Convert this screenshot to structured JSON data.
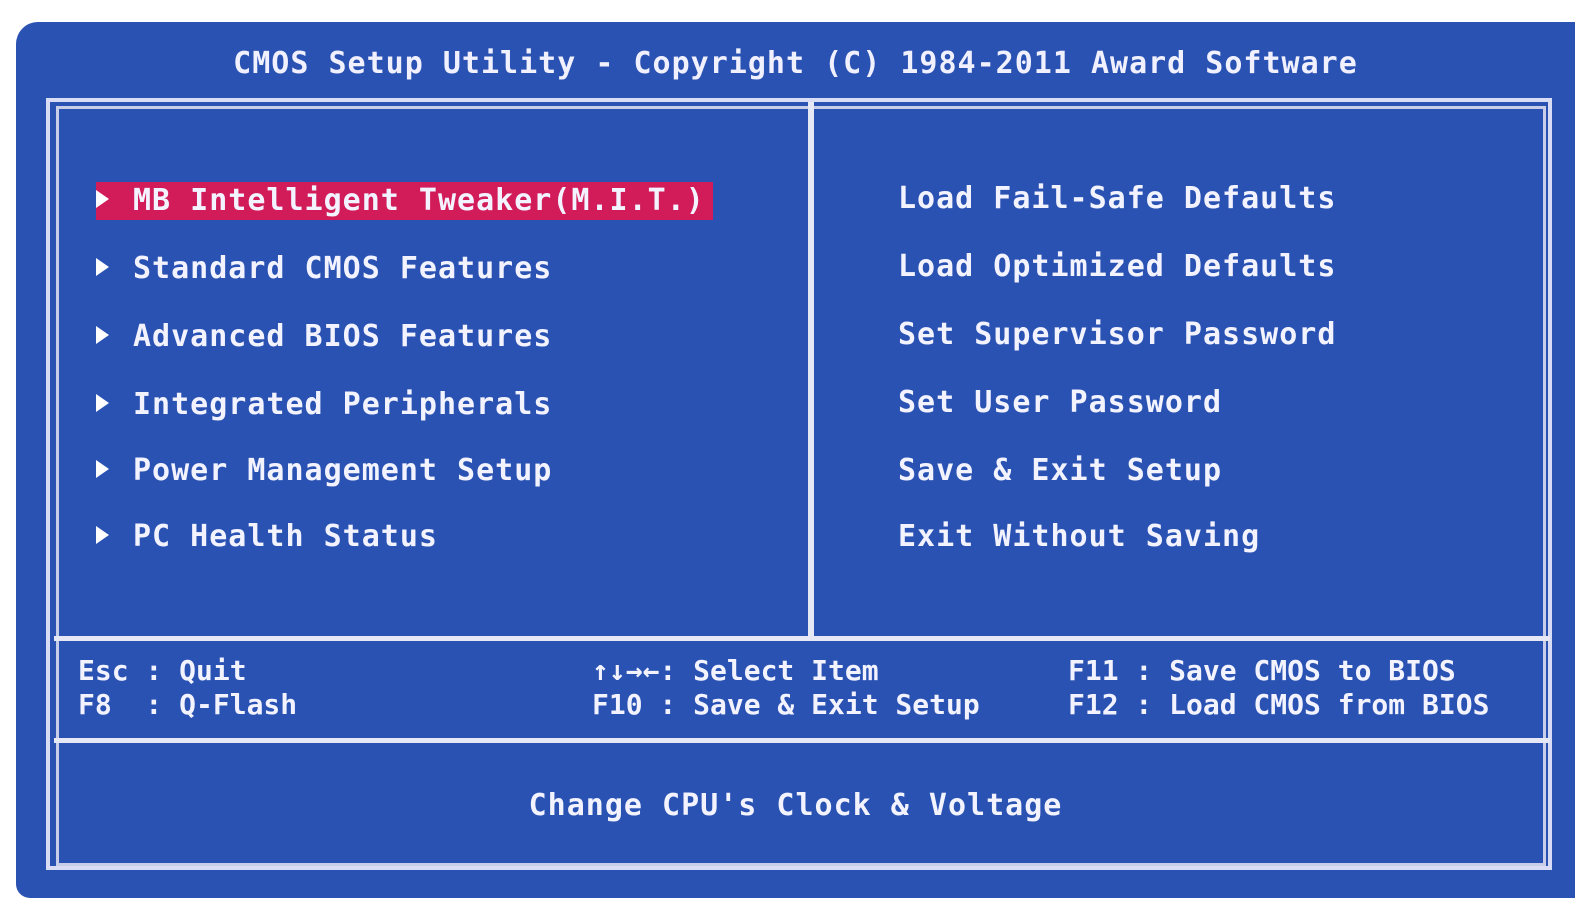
{
  "title": "CMOS Setup Utility - Copyright (C) 1984-2011 Award Software",
  "left_menu": [
    {
      "label": "MB Intelligent Tweaker(M.I.T.)",
      "selected": true
    },
    {
      "label": "Standard CMOS Features",
      "selected": false
    },
    {
      "label": "Advanced BIOS Features",
      "selected": false
    },
    {
      "label": "Integrated Peripherals",
      "selected": false
    },
    {
      "label": "Power Management Setup",
      "selected": false
    },
    {
      "label": "PC Health Status",
      "selected": false
    }
  ],
  "right_menu": [
    {
      "label": "Load Fail-Safe Defaults"
    },
    {
      "label": "Load Optimized Defaults"
    },
    {
      "label": "Set Supervisor Password"
    },
    {
      "label": "Set User Password"
    },
    {
      "label": "Save & Exit Setup"
    },
    {
      "label": "Exit Without Saving"
    }
  ],
  "key_legend": {
    "esc": "Esc : Quit",
    "f8": "F8  : Q-Flash",
    "arrows": "↑↓→←: Select Item",
    "f10": "F10 : Save & Exit Setup",
    "f11": "F11 : Save CMOS to BIOS",
    "f12": "F12 : Load CMOS from BIOS"
  },
  "help_text": "Change CPU's Clock & Voltage",
  "colors": {
    "background": "#2a52b3",
    "highlight": "#d21c5a",
    "frame": "#e6e8f6",
    "text": "#ffffff"
  }
}
